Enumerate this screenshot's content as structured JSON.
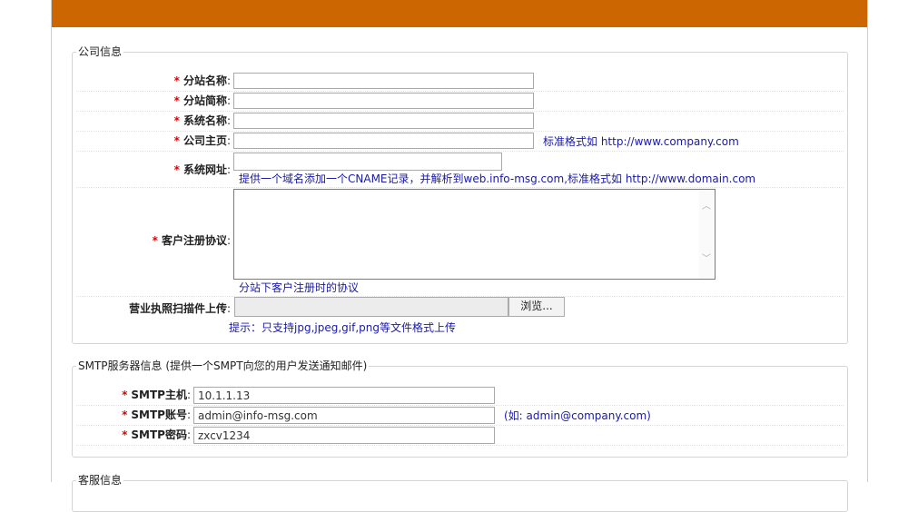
{
  "company": {
    "legend": "公司信息",
    "req_mark": "*",
    "fields": {
      "branch_name": {
        "label": "分站名称",
        "value": ""
      },
      "branch_short": {
        "label": "分站简称",
        "value": ""
      },
      "system_name": {
        "label": "系统名称",
        "value": ""
      },
      "homepage": {
        "label": "公司主页",
        "value": "",
        "hint": "标准格式如 http://www.company.com"
      },
      "system_url": {
        "label": "系统网址",
        "value": "",
        "hint": "提供一个域名添加一个CNAME记录，并解析到web.info-msg.com,标准格式如 http://www.domain.com"
      },
      "agreement": {
        "label": "客户注册协议",
        "value": "",
        "hint": "分站下客户注册时的协议"
      },
      "license": {
        "label": "营业执照扫描件上传",
        "browse_label": "浏览...",
        "hint": "提示：只支持jpg,jpeg,gif,png等文件格式上传"
      }
    },
    "colon": ":"
  },
  "smtp": {
    "legend": "SMTP服务器信息 (提供一个SMPT向您的用户发送通知邮件)",
    "req_mark": "*",
    "colon": ":",
    "host": {
      "label": "SMTP主机",
      "value": "10.1.1.13"
    },
    "account": {
      "label": "SMTP账号",
      "value": "admin@info-msg.com",
      "hint": "(如: admin@company.com)"
    },
    "password": {
      "label": "SMTP密码",
      "value": "zxcv1234"
    }
  },
  "service": {
    "legend": "客服信息"
  },
  "colors": {
    "topbar": "#cc6600",
    "required": "#e00000",
    "hint": "#1a1aa6"
  }
}
